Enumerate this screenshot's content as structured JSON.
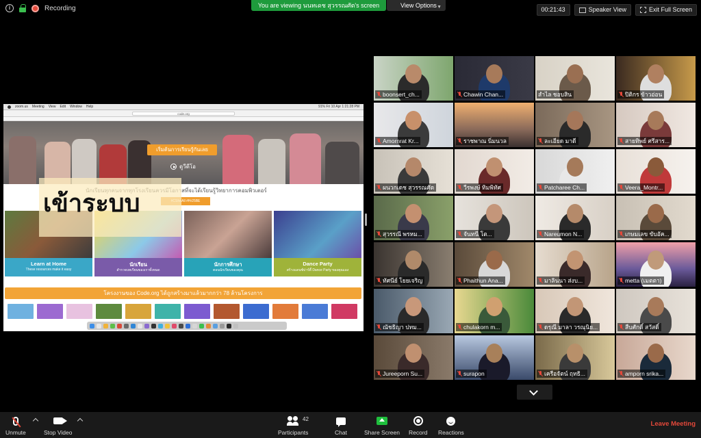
{
  "top_bar": {
    "recording_label": "Recording",
    "viewing_banner": "You are viewing นนทเดช สุวรรณศัต's screen",
    "view_options_label": "View Options",
    "timer": "00:21:43",
    "speaker_view_label": "Speaker View",
    "exit_fullscreen_label": "Exit Full Screen",
    "recording_color": "#e54a3b",
    "banner_color": "#1e9b3c"
  },
  "shared_screen": {
    "menubar_items": [
      "zoom.us",
      "Meeting",
      "View",
      "Edit",
      "Window",
      "Help"
    ],
    "menubar_right": "91%  Fri 10 Apr  1:21:28 PM",
    "url": "code.org",
    "hero_button": "เริ่มต้นการเรียนรู้กันเลย",
    "hero_watch": "ดูวีดีโอ",
    "tagline": "นักเรียนทุกคนจากทุกโรงเรียนควรมีโอกาสที่จะได้เรียนรู้วิทยาการคอมพิวเตอร์",
    "enroll_badge": "#CSforAll #Hr25BE",
    "login_overlay": "เข้าระบบ",
    "cards": [
      {
        "title": "Learn at Home",
        "sub": "These resources make it easy",
        "color": "#3aa7c7"
      },
      {
        "title": "นักเรียน",
        "sub": "สำรวจบทเรียนของเราทั้งหมด",
        "color": "#7a5ba9"
      },
      {
        "title": "นักการศึกษา",
        "sub": "ตอนนักเรียนของคุณ",
        "color": "#28a3b8"
      },
      {
        "title": "Dance Party",
        "sub": "สร้างแดนซ์ปาร์ตี้ Dance Party ของคุณเอง",
        "color": "#9fb33a"
      }
    ],
    "banner": "โครงงานของ Code.org ได้ถูกสร้างมาแล้วมากกว่า 78 ล้านโครงการ"
  },
  "participants": [
    {
      "name": "boonsert_ch...",
      "muted": true
    },
    {
      "name": "Chawin Chan...",
      "muted": true
    },
    {
      "name": "สำไล ชอบสิน",
      "muted": false,
      "active": true
    },
    {
      "name": "ปิติกร ข้าวอ่อน",
      "muted": true
    },
    {
      "name": "Amornrat Kr...",
      "muted": true
    },
    {
      "name": "ราชพาณ นิ่มนวล",
      "muted": true
    },
    {
      "name": "ละเอียด มาดี",
      "muted": true
    },
    {
      "name": "สายทิพย์ ศรีสาร...",
      "muted": true
    },
    {
      "name": "ผนวกเดช สุวรรณศัต",
      "muted": true
    },
    {
      "name": "วีรพงษ์ ทิมพิทัศ",
      "muted": true
    },
    {
      "name": "Patcharee Ch...",
      "muted": true
    },
    {
      "name": "Veera_Montr...",
      "muted": true
    },
    {
      "name": "สุวรรณี พรหม...",
      "muted": true
    },
    {
      "name": "จันทนี โต...",
      "muted": true
    },
    {
      "name": "Nareumon N...",
      "muted": true
    },
    {
      "name": "เกษมเลข ขับอัค...",
      "muted": true
    },
    {
      "name": "ทัศนีย์ โยยเจริญ",
      "muted": true
    },
    {
      "name": "Phaithun Ana...",
      "muted": true
    },
    {
      "name": "มาลินนา ส่งบ...",
      "muted": true
    },
    {
      "name": "metta (เมตตา)",
      "muted": true
    },
    {
      "name": "ณัชธิญา ปทม...",
      "muted": true
    },
    {
      "name": "chulakorn m...",
      "muted": true
    },
    {
      "name": "ดรุณี มาลา วรณุนิย...",
      "muted": true
    },
    {
      "name": "สืบศักดิ์ สวัสดิ์",
      "muted": true
    },
    {
      "name": "Jureeporn Su...",
      "muted": true
    },
    {
      "name": "surapon",
      "muted": true
    },
    {
      "name": "เครือจัตน์ ฤทธิ...",
      "muted": true
    },
    {
      "name": "amporn srika...",
      "muted": true
    }
  ],
  "toolbar": {
    "unmute_label": "Unmute",
    "stop_video_label": "Stop Video",
    "participants_label": "Participants",
    "participants_count": "42",
    "chat_label": "Chat",
    "share_screen_label": "Share Screen",
    "record_label": "Record",
    "reactions_label": "Reactions",
    "leave_label": "Leave Meeting",
    "leave_color": "#e5483a",
    "share_color": "#1fbf3d"
  }
}
